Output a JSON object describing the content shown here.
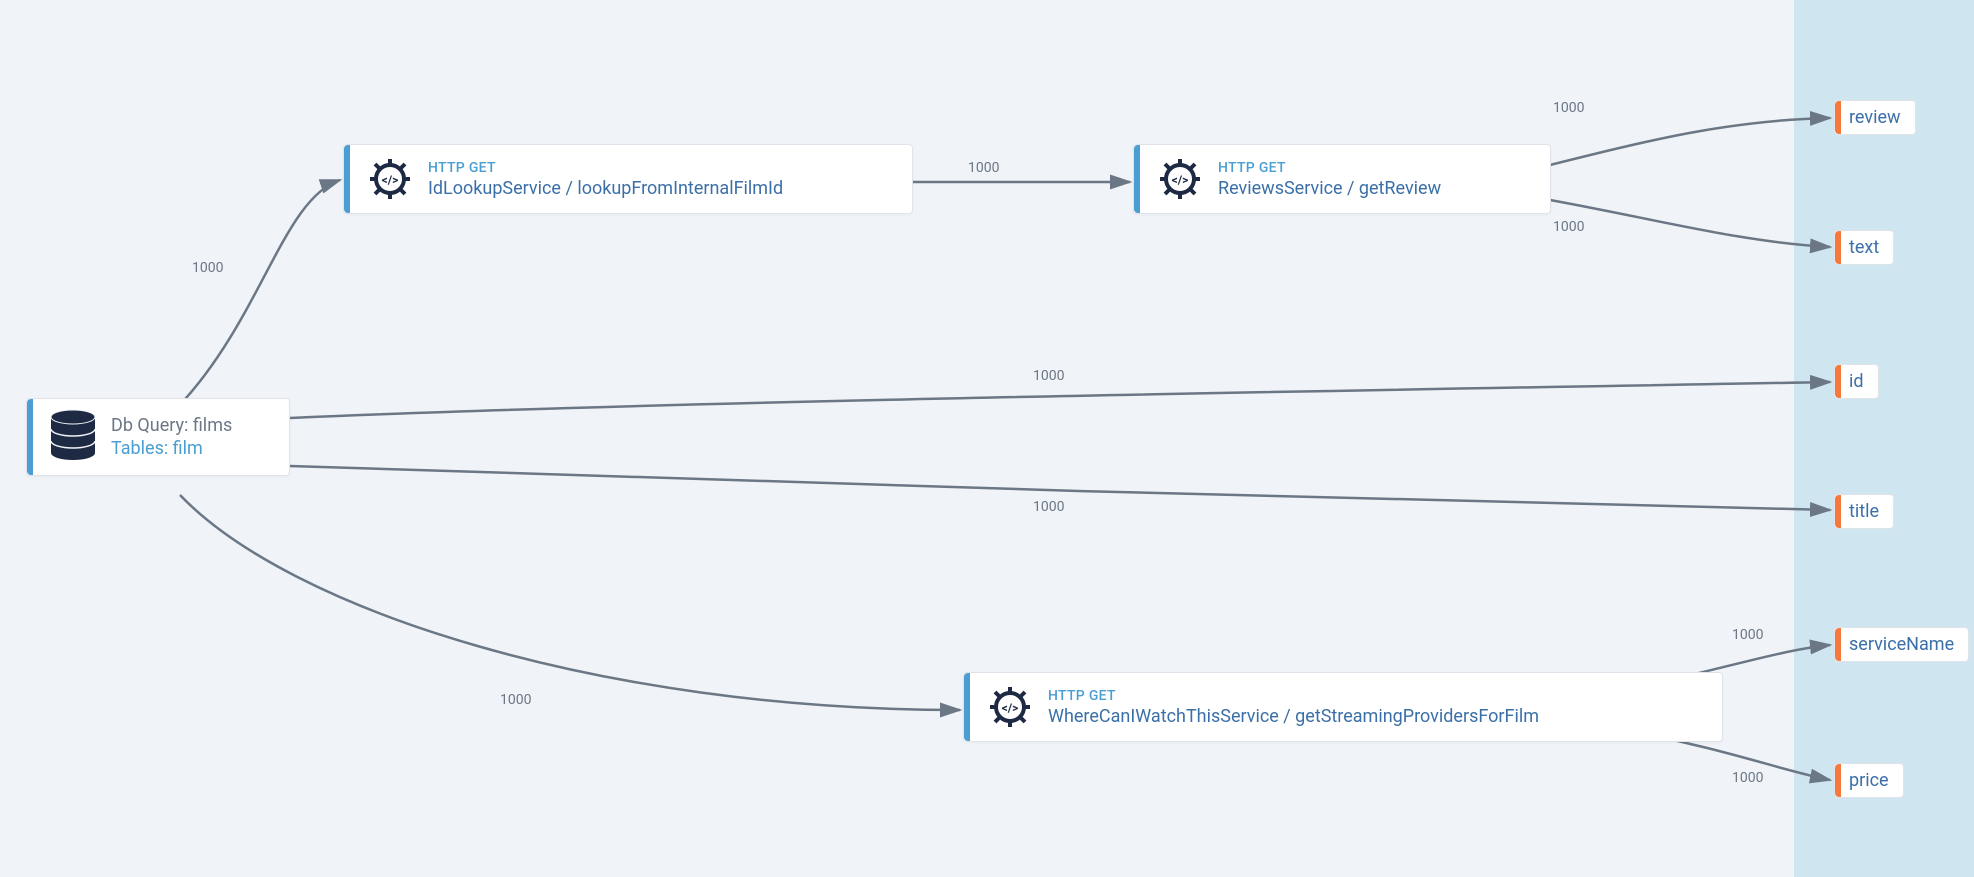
{
  "colors": {
    "blue_accent": "#4a9ed1",
    "orange_accent": "#f37a3a",
    "dark_navy": "#1e2a44"
  },
  "nodes": {
    "db": {
      "title1": "Db Query: films",
      "title2": "Tables: film"
    },
    "idlookup": {
      "method": "HTTP GET",
      "label": "IdLookupService / lookupFromInternalFilmId"
    },
    "reviews": {
      "method": "HTTP GET",
      "label": "ReviewsService / getReview"
    },
    "streaming": {
      "method": "HTTP GET",
      "label": "WhereCanIWatchThisService / getStreamingProvidersForFilm"
    }
  },
  "outputs": {
    "review": "review",
    "text": "text",
    "id": "id",
    "title": "title",
    "serviceName": "serviceName",
    "price": "price"
  },
  "edge_labels": {
    "db_idlookup": "1000",
    "idlookup_reviews": "1000",
    "reviews_review": "1000",
    "reviews_text": "1000",
    "db_id": "1000",
    "db_title": "1000",
    "db_streaming": "1000",
    "streaming_serviceName": "1000",
    "streaming_price": "1000"
  }
}
